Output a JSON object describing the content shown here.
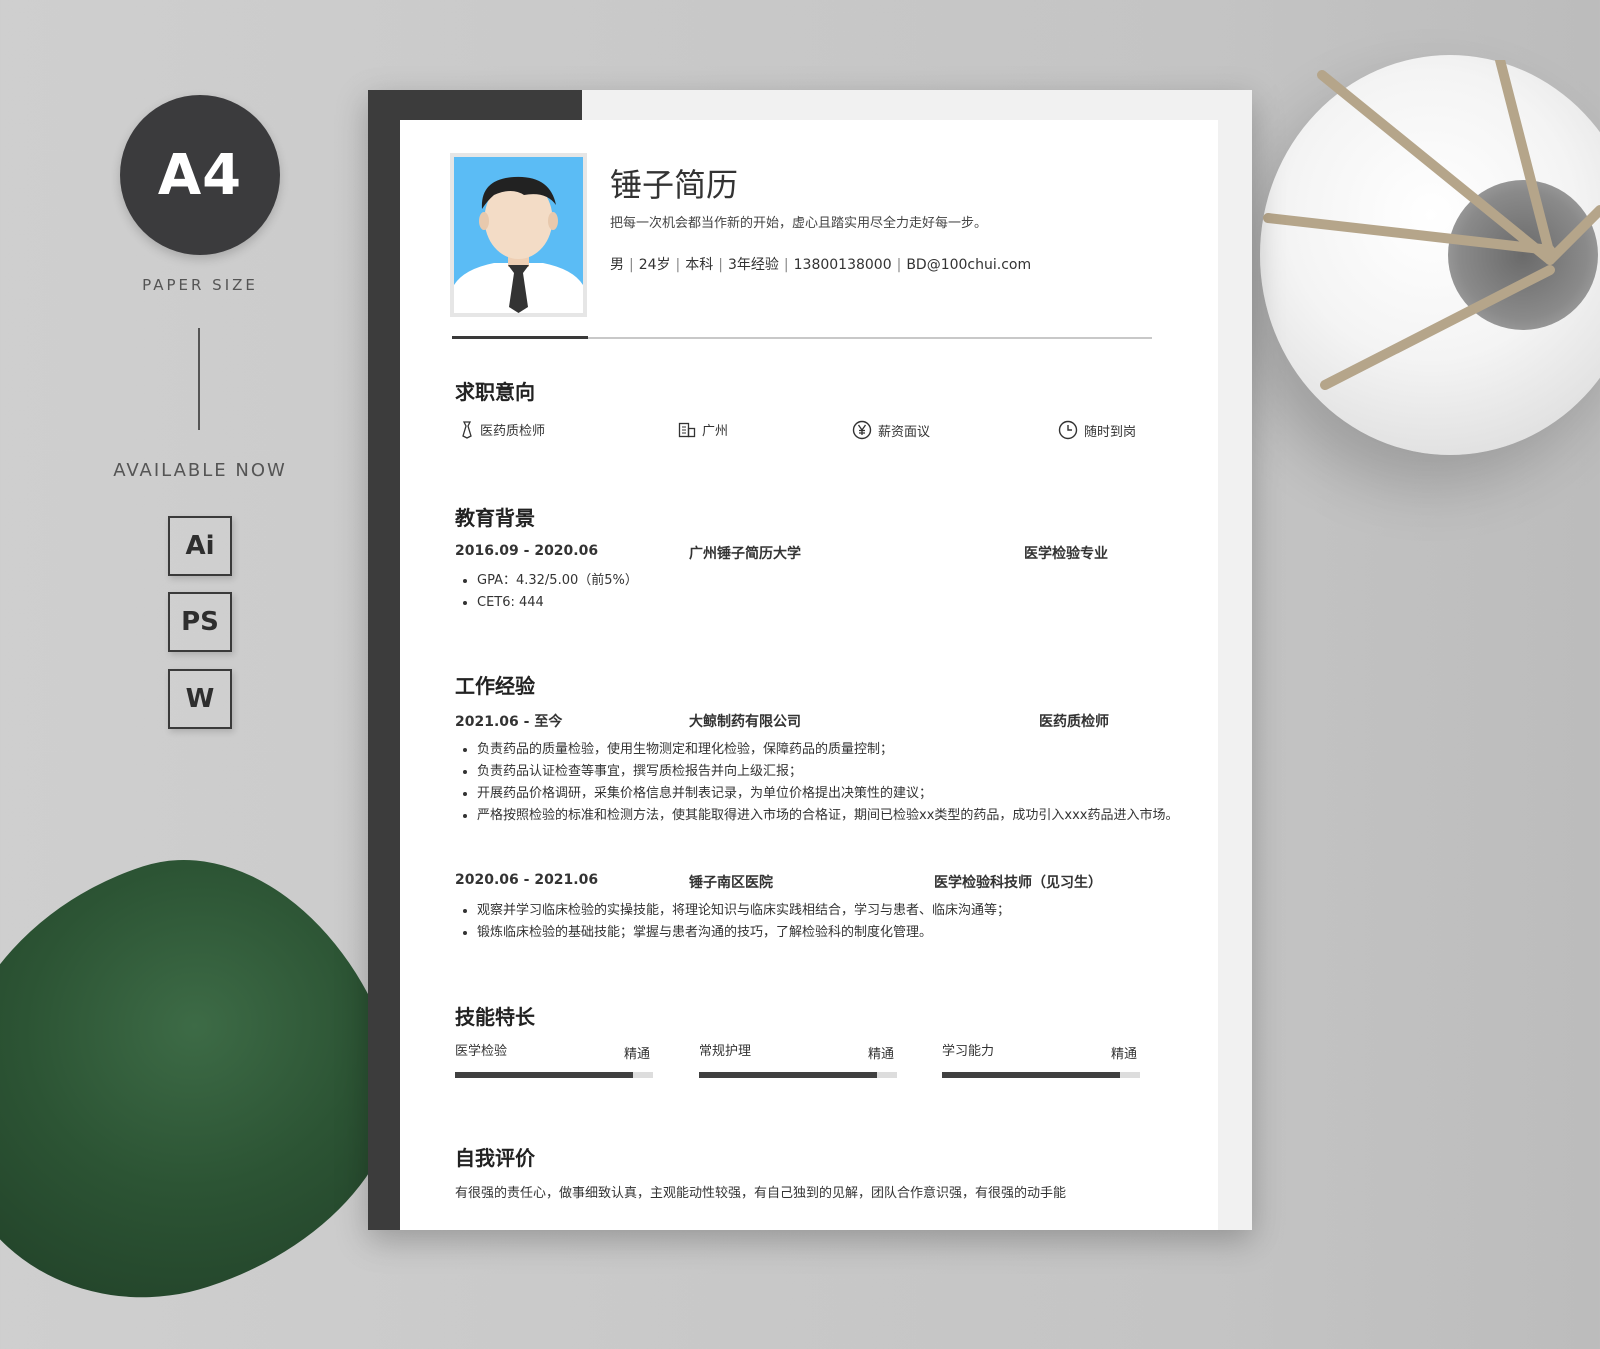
{
  "promo": {
    "badge": "A4",
    "paper_size": "PAPER SIZE",
    "available": "AVAILABLE NOW",
    "formats": [
      "Ai",
      "PS",
      "W"
    ]
  },
  "header": {
    "name": "锤子简历",
    "motto": "把每一次机会都当作新的开始，虚心且踏实用尽全力走好每一步。",
    "info": [
      "男",
      "24岁",
      "本科",
      "3年经验",
      "13800138000",
      "BD@100chui.com"
    ]
  },
  "intention": {
    "title": "求职意向",
    "items": [
      {
        "icon": "tie-icon",
        "text": "医药质检师"
      },
      {
        "icon": "building-icon",
        "text": "广州"
      },
      {
        "icon": "yen-icon",
        "text": "薪资面议"
      },
      {
        "icon": "clock-icon",
        "text": "随时到岗"
      }
    ]
  },
  "education": {
    "title": "教育背景",
    "period": "2016.09 - 2020.06",
    "school": "广州锤子简历大学",
    "major": "医学检验专业",
    "bullets": [
      "GPA：4.32/5.00（前5%）",
      "CET6: 444"
    ]
  },
  "work": {
    "title": "工作经验",
    "jobs": [
      {
        "period": "2021.06 - 至今",
        "company": "大鲸制药有限公司",
        "role": "医药质检师",
        "bullets": [
          "负责药品的质量检验，使用生物测定和理化检验，保障药品的质量控制；",
          "负责药品认证检查等事宜，撰写质检报告并向上级汇报；",
          "开展药品价格调研，采集价格信息并制表记录，为单位价格提出决策性的建议；",
          "严格按照检验的标准和检测方法，使其能取得进入市场的合格证，期间已检验xx类型的药品，成功引入xxx药品进入市场。"
        ]
      },
      {
        "period": "2020.06 - 2021.06",
        "company": "锤子南区医院",
        "role": "医学检验科技师（见习生）",
        "bullets": [
          "观察并学习临床检验的实操技能，将理论知识与临床实践相结合，学习与患者、临床沟通等；",
          "锻炼临床检验的基础技能；掌握与患者沟通的技巧，了解检验科的制度化管理。"
        ]
      }
    ]
  },
  "skills": {
    "title": "技能特长",
    "items": [
      {
        "label": "医学检验",
        "level": "精通",
        "value": 0.9
      },
      {
        "label": "常规护理",
        "level": "精通",
        "value": 0.9
      },
      {
        "label": "学习能力",
        "level": "精通",
        "value": 0.9
      }
    ]
  },
  "self_evaluation": {
    "title": "自我评价",
    "text": "有很强的责任心，做事细致认真，主观能动性较强，有自己独到的见解，团队合作意识强，有很强的动手能"
  },
  "colors": {
    "dark": "#3c3c3c",
    "photo_bg": "#5bbcf5",
    "accent_bar": "#404040"
  }
}
